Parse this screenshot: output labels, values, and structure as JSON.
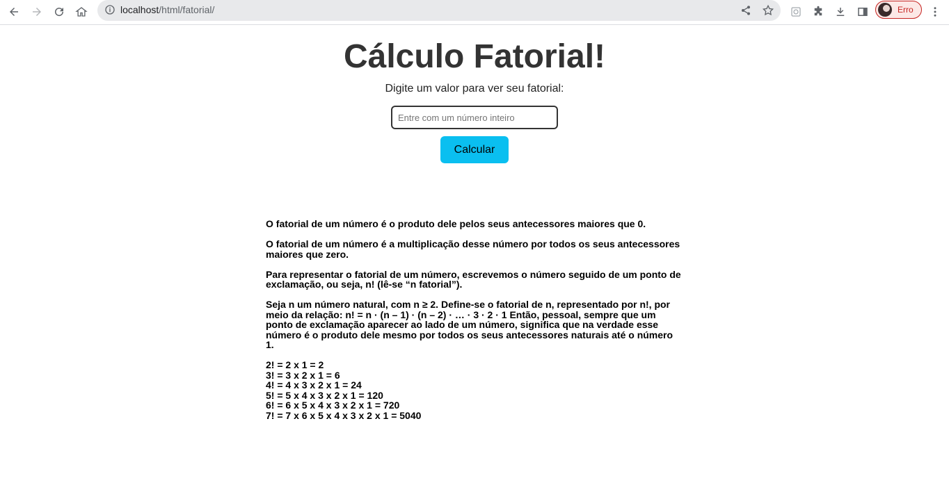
{
  "browser": {
    "url_host": "localhost",
    "url_path": "/html/fatorial/",
    "profile_label": "Erro"
  },
  "page": {
    "title": "Cálculo Fatorial!",
    "prompt": "Digite um valor para ver seu fatorial:",
    "input_placeholder": "Entre com um número inteiro",
    "input_value": "",
    "button_label": "Calcular",
    "paragraphs": [
      "O fatorial de um número é o produto dele pelos seus antecessores maiores que 0.",
      "O fatorial de um número é a multiplicação desse número por todos os seus antecessores maiores que zero.",
      "Para representar o fatorial de um número, escrevemos o número seguido de um ponto de exclamação, ou seja, n! (lê-se “n fatorial”).",
      "Seja n um número natural, com n ≥ 2. Define-se o fatorial de n, representado por n!, por meio da relação: n! = n · (n – 1) · (n – 2) · … · 3 · 2 · 1 Então, pessoal, sempre que um ponto de exclamação aparecer ao lado de um número, significa que na verdade esse número é o produto dele mesmo por todos os seus antecessores naturais até o número 1."
    ],
    "examples": [
      "2! = 2 x 1 = 2",
      "3! = 3 x 2 x 1 = 6",
      "4! = 4 x 3 x 2 x 1 = 24",
      "5! = 5 x 4 x 3 x 2 x 1 = 120",
      "6! = 6 x 5 x 4 x 3 x 2 x 1 = 720",
      "7! = 7 x 6 x 5 x 4 x 3 x 2 x 1 = 5040"
    ]
  },
  "colors": {
    "button_bg": "#0abff0",
    "title": "#333333",
    "profile_error": "#c5221f"
  }
}
